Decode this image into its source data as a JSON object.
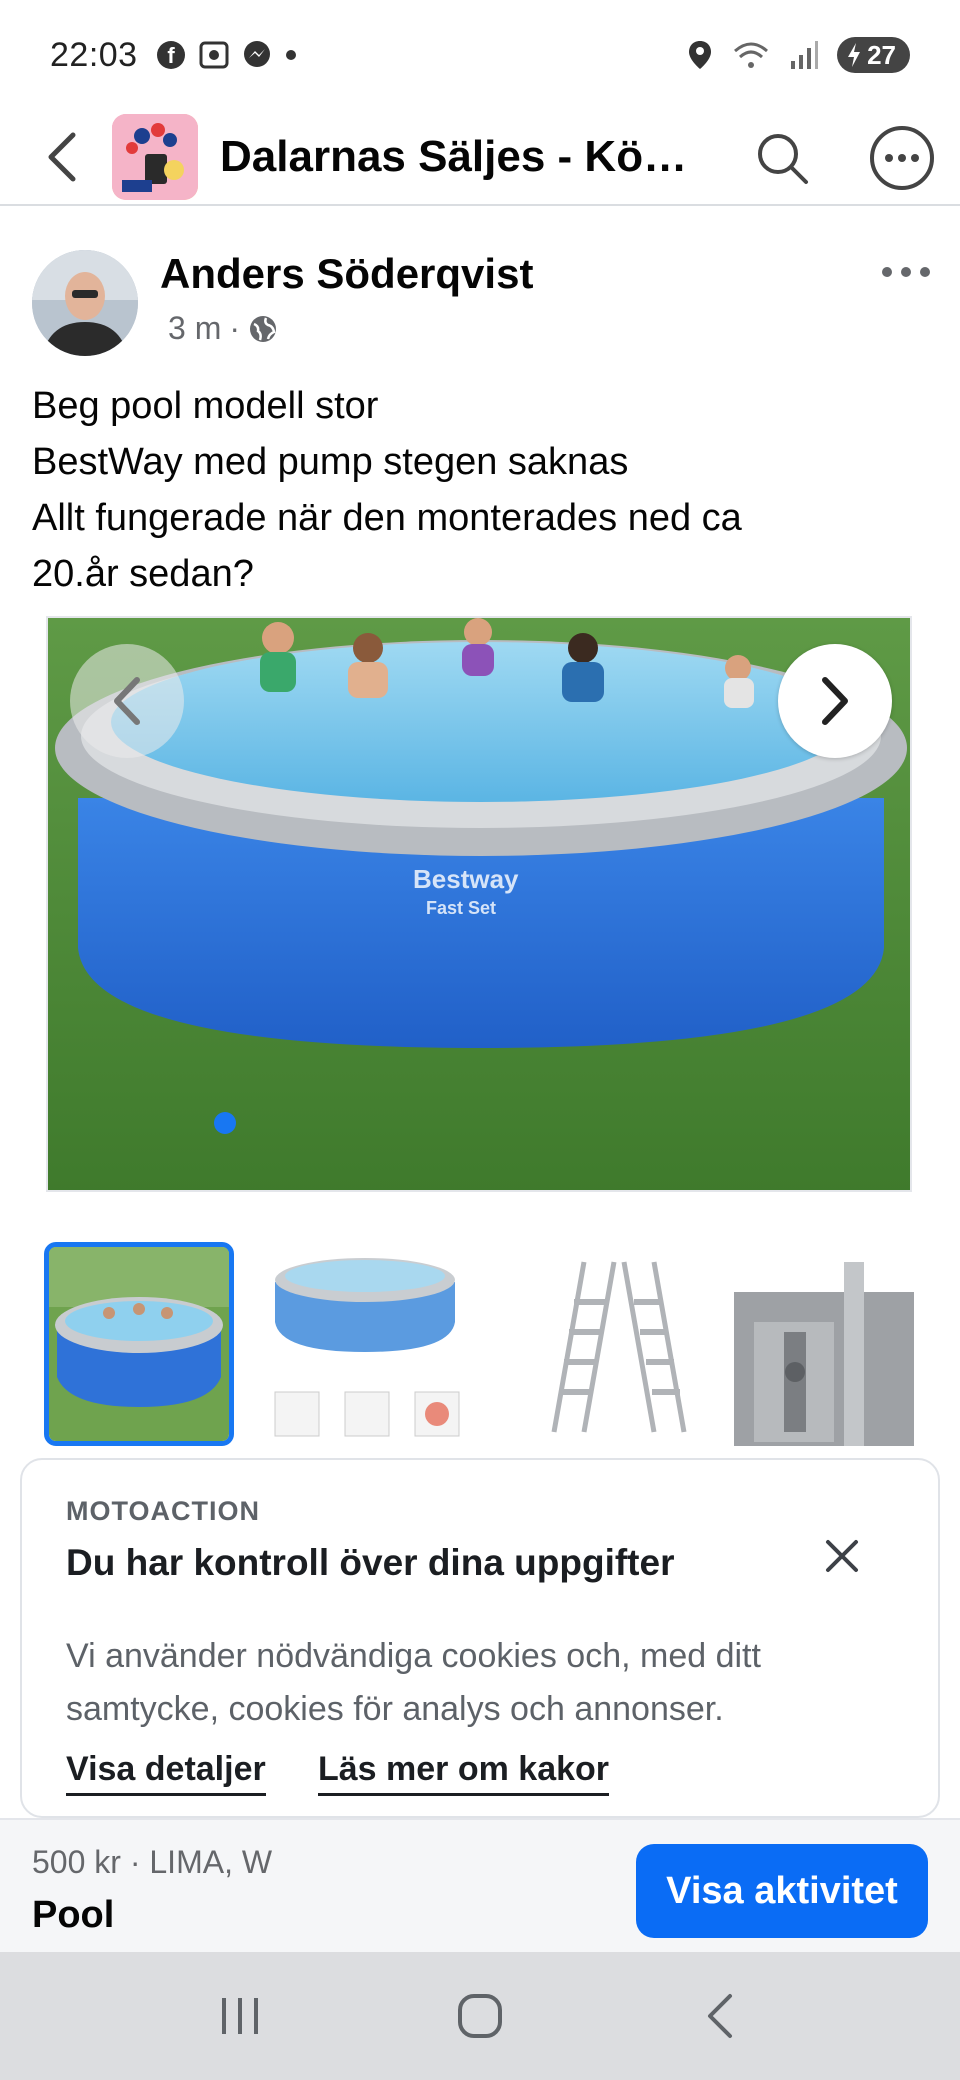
{
  "status_bar": {
    "time": "22:03",
    "left_icons": [
      "facebook-icon",
      "screenshot-icon",
      "messenger-icon",
      "notification-dot-icon"
    ],
    "right_icons": [
      "location-icon",
      "wifi-icon",
      "signal-icon"
    ],
    "battery_level": "27"
  },
  "header": {
    "title": "Dalarnas Säljes - Köp…",
    "back_icon": "back-arrow-icon",
    "search_icon": "search-icon",
    "more_icon": "more-options-icon"
  },
  "post": {
    "author": "Anders Söderqvist",
    "time_ago": "3 m",
    "separator": "·",
    "privacy_icon": "globe-icon",
    "text": "Beg pool modell stor\nBestWay med pump stegen saknas\nAllt fungerade när den monterades ned ca\n20.år sedan?",
    "image_brand_line1": "Bestway",
    "image_brand_line2": "Fast Set",
    "active_slide": 1
  },
  "thumbnails": [
    {
      "name": "pool-photo"
    },
    {
      "name": "pool-product"
    },
    {
      "name": "ladder"
    },
    {
      "name": "pump"
    }
  ],
  "cookie_notice": {
    "brand": "MOTOACTION",
    "heading": "Du har kontroll över dina uppgifter",
    "body": "Vi använder nödvändiga cookies och, med ditt samtycke, cookies för analys och annonser.",
    "link_details": "Visa detaljer",
    "link_more": "Läs mer om kakor"
  },
  "listing": {
    "price_location": "500 kr · LIMA, W",
    "title": "Pool",
    "cta_label": "Visa aktivitet"
  },
  "colors": {
    "accent": "#0a6cf5",
    "pool_blue": "#2f72d8",
    "grass": "#4f8a3a"
  }
}
